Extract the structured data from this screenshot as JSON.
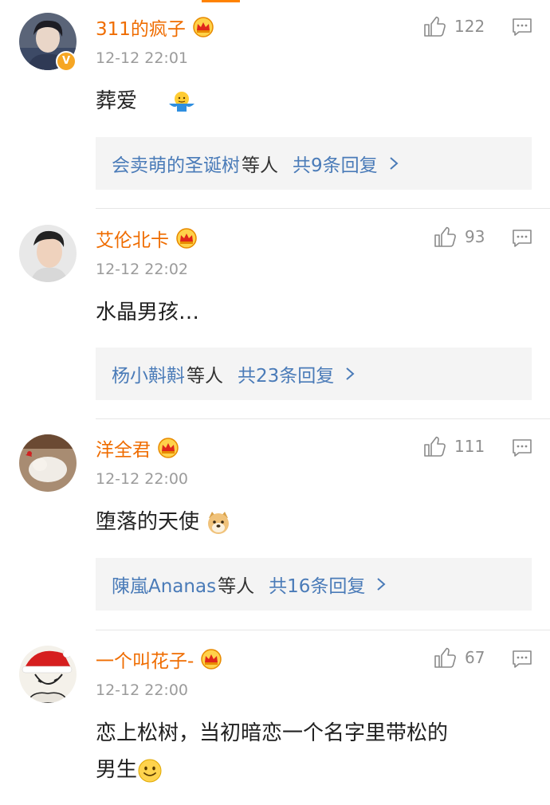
{
  "comments": [
    {
      "username": "311的疯子",
      "timestamp": "12-12 22:01",
      "likes": "122",
      "verified": true,
      "text": "葬爱",
      "reply_users": "会卖萌的圣诞树",
      "reply_suffix": "等人",
      "reply_total": "共9条回复"
    },
    {
      "username": "艾伦北卡",
      "timestamp": "12-12 22:02",
      "likes": "93",
      "verified": false,
      "text": "水晶男孩…",
      "reply_users": "杨小斢斢",
      "reply_suffix": "等人",
      "reply_total": "共23条回复"
    },
    {
      "username": "洋全君",
      "timestamp": "12-12 22:00",
      "likes": "111",
      "verified": false,
      "text": "堕落的天使",
      "reply_users": "陳嵐Ananas",
      "reply_suffix": "等人",
      "reply_total": "共16条回复"
    },
    {
      "username": "一个叫花子-",
      "timestamp": "12-12 22:00",
      "likes": "67",
      "verified": false,
      "text_line1": "恋上松树，当初暗恋一个名字里带松的",
      "text_line2": "男生"
    }
  ],
  "colors": {
    "username": "#ef6c00",
    "reply_link": "#4a7bb8",
    "reply_bg": "#f4f4f4",
    "accent": "#ff8200",
    "meta_gray": "#9b9b9b"
  },
  "icons": [
    "thumbs-up-icon",
    "comment-icon",
    "crown-badge-icon",
    "verified-badge-icon",
    "chevron-right-icon",
    "shrug-emoji",
    "doge-emoji",
    "smile-emoji"
  ]
}
